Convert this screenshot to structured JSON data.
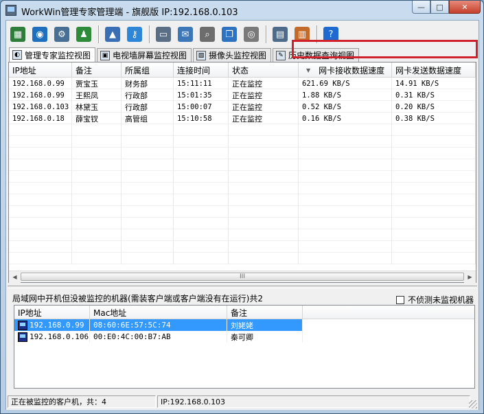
{
  "window": {
    "title": "WorkWin管理专家管理端 - 旗舰版 IP:192.168.0.103",
    "buttons": {
      "minimize": "—",
      "maximize": "□",
      "close": "✕"
    }
  },
  "toolbar": {
    "groups": [
      [
        {
          "name": "console-icon",
          "glyph": "▦",
          "color": "#2f7d3b"
        },
        {
          "name": "globe-icon",
          "glyph": "◉",
          "color": "#1f6fbf"
        },
        {
          "name": "computer-settings-icon",
          "glyph": "⚙",
          "color": "#4a6f95"
        },
        {
          "name": "users-icon",
          "glyph": "♟",
          "color": "#2e8b3a"
        }
      ],
      [
        {
          "name": "chart-icon",
          "glyph": "▲",
          "color": "#3b6fb5"
        },
        {
          "name": "key-icon",
          "glyph": "⚷",
          "color": "#2e86d6"
        }
      ],
      [
        {
          "name": "monitor-icon",
          "glyph": "▭",
          "color": "#5a6f85"
        },
        {
          "name": "email-icon",
          "glyph": "✉",
          "color": "#3c77b7"
        },
        {
          "name": "magnifier-icon",
          "glyph": "⌕",
          "color": "#6d6d6d"
        },
        {
          "name": "windows-icon",
          "glyph": "❐",
          "color": "#2f73c0"
        },
        {
          "name": "disc-icon",
          "glyph": "◎",
          "color": "#7a7a7a"
        }
      ],
      [
        {
          "name": "server-icon",
          "glyph": "▤",
          "color": "#4f6b8a"
        },
        {
          "name": "report-icon",
          "glyph": "▥",
          "color": "#c46a2a"
        }
      ],
      [
        {
          "name": "help-icon",
          "glyph": "?",
          "color": "#1e6ad0"
        }
      ]
    ]
  },
  "tabs": [
    {
      "label": "管理专家监控视图",
      "active": true,
      "icon": "◐"
    },
    {
      "label": "电视墙屏幕监控视图",
      "active": false,
      "icon": "▣"
    },
    {
      "label": "摄像头监控视图",
      "active": false,
      "icon": "▧"
    },
    {
      "label": "历史数据查询视图",
      "active": false,
      "icon": "✎"
    }
  ],
  "main_table": {
    "columns": [
      "IP地址",
      "备注",
      "所属组",
      "连接时间",
      "状态",
      "网卡接收数据速度",
      "网卡发送数据速度"
    ],
    "sort_indicator": "▼",
    "rows": [
      [
        "192.168.0.99",
        "贾宝玉",
        "财务部",
        "15:11:11",
        "正在监控",
        "621.69 KB/S",
        "14.91 KB/S"
      ],
      [
        "192.168.0.99",
        "王熙凤",
        "行政部",
        "15:01:35",
        "正在监控",
        "1.88 KB/S",
        "0.31 KB/S"
      ],
      [
        "192.168.0.103",
        "林黛玉",
        "行政部",
        "15:00:07",
        "正在监控",
        "0.52 KB/S",
        "0.20 KB/S"
      ],
      [
        "192.168.0.18",
        "薛宝钗",
        "高管组",
        "15:10:58",
        "正在监控",
        "0.16 KB/S",
        "0.38 KB/S"
      ]
    ],
    "hscroll": {
      "left": "◀",
      "right": "▶",
      "thumb": "III"
    }
  },
  "lower_panel": {
    "title": "局域网中开机但没被监控的机器(需装客户端或客户端没有在运行)共2",
    "checkbox_label": "不侦测未监视机器",
    "columns": [
      "IP地址",
      "Mac地址",
      "备注"
    ],
    "rows": [
      [
        "192.168.0.99",
        "08:60:6E:57:5C:74",
        "刘姥姥"
      ],
      [
        "192.168.0.106",
        "00:E0:4C:00:B7:AB",
        "秦可卿"
      ]
    ]
  },
  "statusbar": {
    "left": "正在被监控的客户机，共：4",
    "right": "IP:192.168.0.103"
  },
  "colors": {
    "highlight_box": "#d0202a",
    "selection": "#3399ff"
  }
}
